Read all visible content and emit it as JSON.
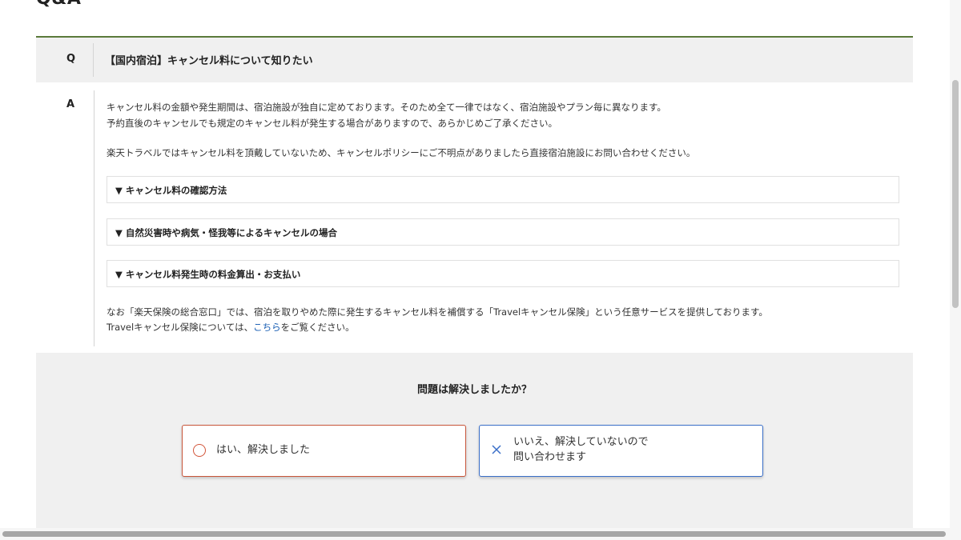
{
  "page": {
    "title": "Q&A"
  },
  "question": {
    "mark": "Q",
    "text": "【国内宿泊】キャンセル料について知りたい"
  },
  "answer": {
    "mark": "A",
    "line1": "キャンセル料の金額や発生期間は、宿泊施設が独自に定めております。そのため全て一律ではなく、宿泊施設やプラン毎に異なります。",
    "line2": "予約直後のキャンセルでも規定のキャンセル料が発生する場合がありますので、あらかじめご了承ください。",
    "line3": "楽天トラベルではキャンセル料を頂戴していないため、キャンセルポリシーにご不明点がありましたら直接宿泊施設にお問い合わせください。",
    "accordions": [
      "▼ キャンセル料の確認方法",
      "▼ 自然災害時や病気・怪我等によるキャンセルの場合",
      "▼ キャンセル料発生時の料金算出・お支払い"
    ],
    "note1": "なお「楽天保険の総合窓口」では、宿泊を取りやめた際に発生するキャンセル料を補償する「Travelキャンセル保険」という任意サービスを提供しております。",
    "note2_prefix": "Travelキャンセル保険については、",
    "note2_link": "こちら",
    "note2_suffix": "をご覧ください。"
  },
  "feedback": {
    "question": "問題は解決しましたか？",
    "yes_label": "はい、解決しました",
    "no_label_line1": "いいえ、解決していないので",
    "no_label_line2": "問い合わせます",
    "yes_icon": "circle-icon",
    "no_icon": "x-icon"
  },
  "colors": {
    "accent_green": "#5a7a3a",
    "yes_border": "#c8553a",
    "no_border": "#3a6fc8",
    "link": "#1a5fb4"
  }
}
